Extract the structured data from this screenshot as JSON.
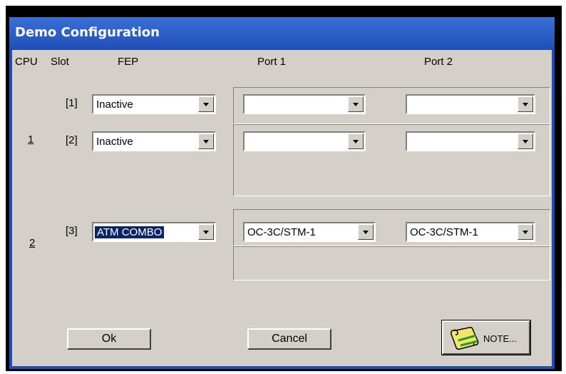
{
  "window": {
    "title": "Demo Configuration"
  },
  "headers": {
    "cpu": "CPU",
    "slot": "Slot",
    "fep": "FEP",
    "port1": "Port 1",
    "port2": "Port 2"
  },
  "cpus": [
    {
      "label": "1"
    },
    {
      "label": "2"
    }
  ],
  "slots": [
    {
      "label": "[1]",
      "fep": "Inactive",
      "port1": "",
      "port2": ""
    },
    {
      "label": "[2]",
      "fep": "Inactive",
      "port1": "",
      "port2": ""
    },
    {
      "label": "[3]",
      "fep": "ATM COMBO",
      "port1": "OC-3C/STM-1",
      "port2": "OC-3C/STM-1"
    }
  ],
  "buttons": {
    "ok": "Ok",
    "cancel": "Cancel",
    "note": "NOTE..."
  },
  "icons": {
    "note": "scroll-icon"
  },
  "colors": {
    "titlebar": "#1f4fb5",
    "dialog": "#d4d0c8",
    "selection": "#0a246a"
  }
}
